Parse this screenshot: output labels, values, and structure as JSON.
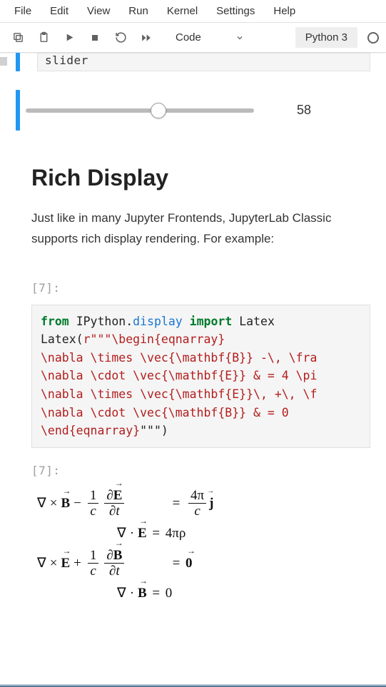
{
  "menubar": {
    "items": [
      "File",
      "Edit",
      "View",
      "Run",
      "Kernel",
      "Settings",
      "Help"
    ]
  },
  "toolbar": {
    "celltype": "Code",
    "kernel": "Python 3"
  },
  "peek_code_text": "slider",
  "slider": {
    "value": "58",
    "position_pct": 58
  },
  "markdown": {
    "heading": "Rich Display",
    "paragraph": "Just like in many Jupyter Frontends, JupyterLab Classic supports rich display rendering. For example:"
  },
  "code_cell": {
    "prompt_in": "[7]:",
    "prompt_out": "[7]:",
    "lines": {
      "l0_kw1": "from",
      "l0_mod1": "IPython",
      "l0_dot": ".",
      "l0_mod2": "display",
      "l0_kw2": "import",
      "l0_name": "Latex",
      "l1a": "Latex(",
      "l1b": "r\"\"\"\\begin{eqnarray}",
      "l2": "\\nabla \\times \\vec{\\mathbf{B}} -\\, \\fra",
      "l3": "\\nabla \\cdot \\vec{\\mathbf{E}} & = 4 \\pi",
      "l4": "\\nabla \\times \\vec{\\mathbf{E}}\\, +\\, \\f",
      "l5": "\\nabla \\cdot \\vec{\\mathbf{B}} & = 0",
      "l6a": "\\end{eqnarray}",
      "l6b": "\"\"\"",
      "l6c": ")",
      "eq_values": {
        "rhs2": "4πρ",
        "rhs4": "0"
      }
    }
  }
}
